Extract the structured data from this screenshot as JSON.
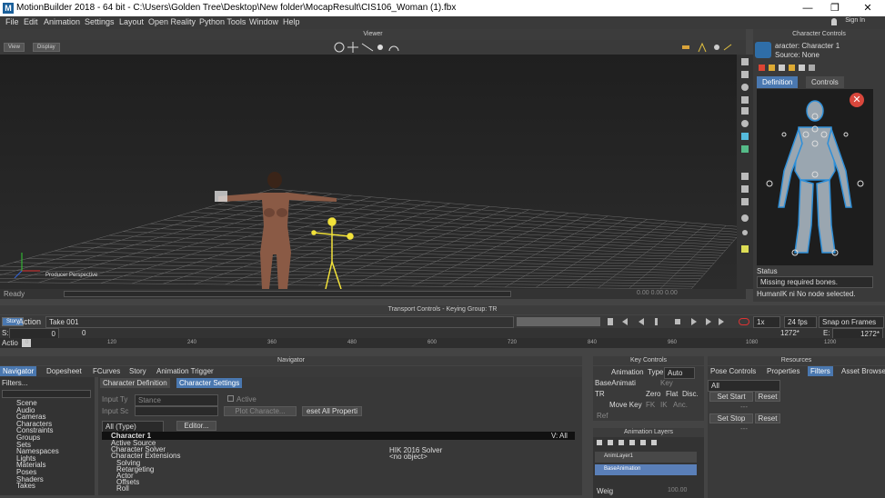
{
  "titlebar": {
    "app_title": "MotionBuilder 2018 - 64 bit - C:\\Users\\Golden Tree\\Desktop\\New folder\\MocapResult\\CIS106_Woman (1).fbx",
    "logo": "M",
    "minimize": "—",
    "restore": "❐",
    "close": "✕"
  },
  "menubar": {
    "items": [
      "File",
      "Edit",
      "Animation",
      "Settings",
      "Layout",
      "Open Reality",
      "Python Tools",
      "Window",
      "Help"
    ],
    "sign_in": "Sign In"
  },
  "viewer": {
    "title": "Viewer",
    "view_btn": "View",
    "display_btn": "Display",
    "camera_label": "Producer Perspective",
    "status": "Ready",
    "readout": "0.00  0.00  0.00"
  },
  "character_controls": {
    "panel_title": "Character Controls",
    "character_label": "aracter: Character 1",
    "source_label": "Source: None",
    "tab_definition": "Definition",
    "tab_controls": "Controls",
    "status_label": "Status",
    "status_value": "Missing required bones.",
    "humanik_msg": "HumanIK ni No node selected."
  },
  "transport": {
    "title": "Transport Controls  -  Keying Group: TR",
    "story_btn": "Story",
    "action_label": "Action",
    "take": "Take 001",
    "speed": "1x",
    "fps": "24 fps",
    "snap": "Snap on Frames",
    "start_label": "S:",
    "start_val": "0",
    "cur_val": "0",
    "end_val": "1272*",
    "end_label": "E:",
    "end_val2": "1272*",
    "action_short": "Actio",
    "ticks": [
      "0",
      "120",
      "240",
      "360",
      "480",
      "600",
      "720",
      "840",
      "960",
      "1080",
      "1200"
    ]
  },
  "navigator": {
    "title": "Navigator",
    "tabs": [
      "Navigator",
      "Dopesheet",
      "FCurves",
      "Story",
      "Animation Trigger"
    ],
    "filters_label": "Filters...",
    "tree": [
      "Scene",
      "Audio",
      "Cameras",
      "Characters",
      "Constraints",
      "Groups",
      "Sets",
      "Namespaces",
      "Lights",
      "Materials",
      "Poses",
      "Shaders",
      "Takes"
    ],
    "sub_tabs": [
      "Character Definition",
      "Character Settings"
    ],
    "input_type_label": "Input Ty",
    "input_type_value": "Stance",
    "active_label": "Active",
    "input_src_label": "Input Sc",
    "plot_btn": "Plot Characte...",
    "reset_btn": "eset All Properti",
    "all_type": "All (Type)",
    "editor_btn": "Editor...",
    "char_name": "Character 1",
    "v_all": "V: All",
    "props": [
      "Active Source",
      "Character Solver",
      "Character Extensions",
      "Solving",
      "Retargeting",
      "Actor",
      "Offsets",
      "Roll"
    ],
    "solver_value": "HIK 2016 Solver",
    "solver_obj": "<no object>"
  },
  "key_controls": {
    "title": "Key Controls",
    "animation_label": "Animation",
    "type_label": "Type",
    "type_value": "Auto",
    "base_anim": "BaseAnimati",
    "key_label": "Key",
    "tr_label": "TR",
    "zero": "Zero",
    "flat": "Flat",
    "disc": "Disc.",
    "move_keys": "Move Key",
    "fk": "FK",
    "ik": "IK",
    "anc": "Anc.",
    "ref_label": "Ref"
  },
  "anim_layers": {
    "title": "Animation Layers",
    "layers": [
      "AnimLayer1",
      "BaseAnimation"
    ],
    "weight_label": "Weig",
    "weight_val": "100.00"
  },
  "resources": {
    "title": "Resources",
    "tabs": [
      "Pose Controls",
      "Properties",
      "Filters",
      "Asset Browser"
    ],
    "all": "All",
    "set_start": "Set Start",
    "reset1": "Reset",
    "set_stop": "Set Stop",
    "reset2": "Reset",
    "dash1": "---",
    "dash2": "---"
  },
  "colors": {
    "accent": "#4a78b0",
    "selected_layer": "#5a7fb8",
    "close_red": "#d9473c",
    "body_blue": "#2e8fd8"
  }
}
